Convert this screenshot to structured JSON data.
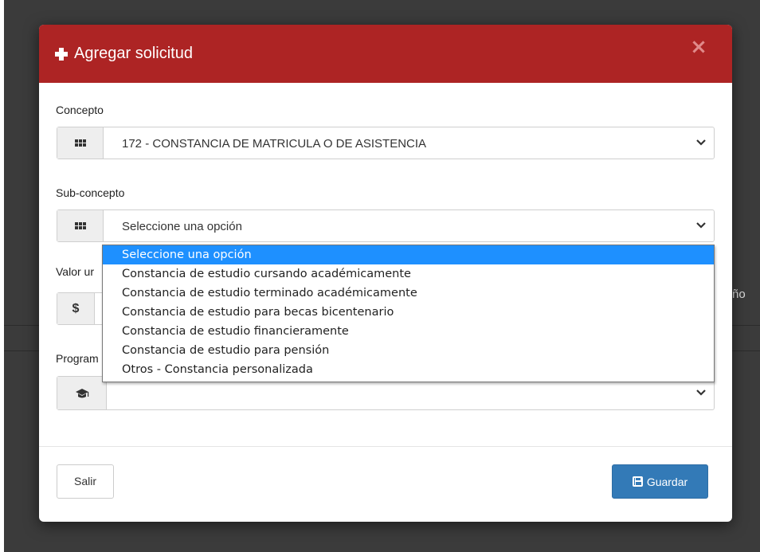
{
  "background": {
    "right_fragment": "ño"
  },
  "modal": {
    "title": "Agregar solicitud",
    "close_label": "×",
    "header_color": "#ad2424"
  },
  "concepto": {
    "label": "Concepto",
    "icon": "th-grid-icon",
    "selected_value": "172 - CONSTANCIA DE MATRICULA O DE ASISTENCIA"
  },
  "subconcepto": {
    "label": "Sub-concepto",
    "icon": "th-grid-icon",
    "selected_value": "Seleccione una opción",
    "options": [
      "Seleccione una opción",
      "Constancia de estudio cursando académicamente",
      "Constancia de estudio terminado académicamente",
      "Constancia de estudio para becas bicentenario",
      "Constancia de estudio financieramente",
      "Constancia de estudio para pensión",
      "Otros - Constancia personalizada"
    ],
    "highlighted_index": 0,
    "highlight_color": "#1e90ff"
  },
  "valor": {
    "label": "Valor ur",
    "icon": "dollar-icon",
    "symbol": "$"
  },
  "programa": {
    "label": "Program",
    "icon": "graduation-cap-icon",
    "selected_value": ""
  },
  "footer": {
    "exit_label": "Salir",
    "save_label": "Guardar",
    "save_color": "#337ab7"
  }
}
